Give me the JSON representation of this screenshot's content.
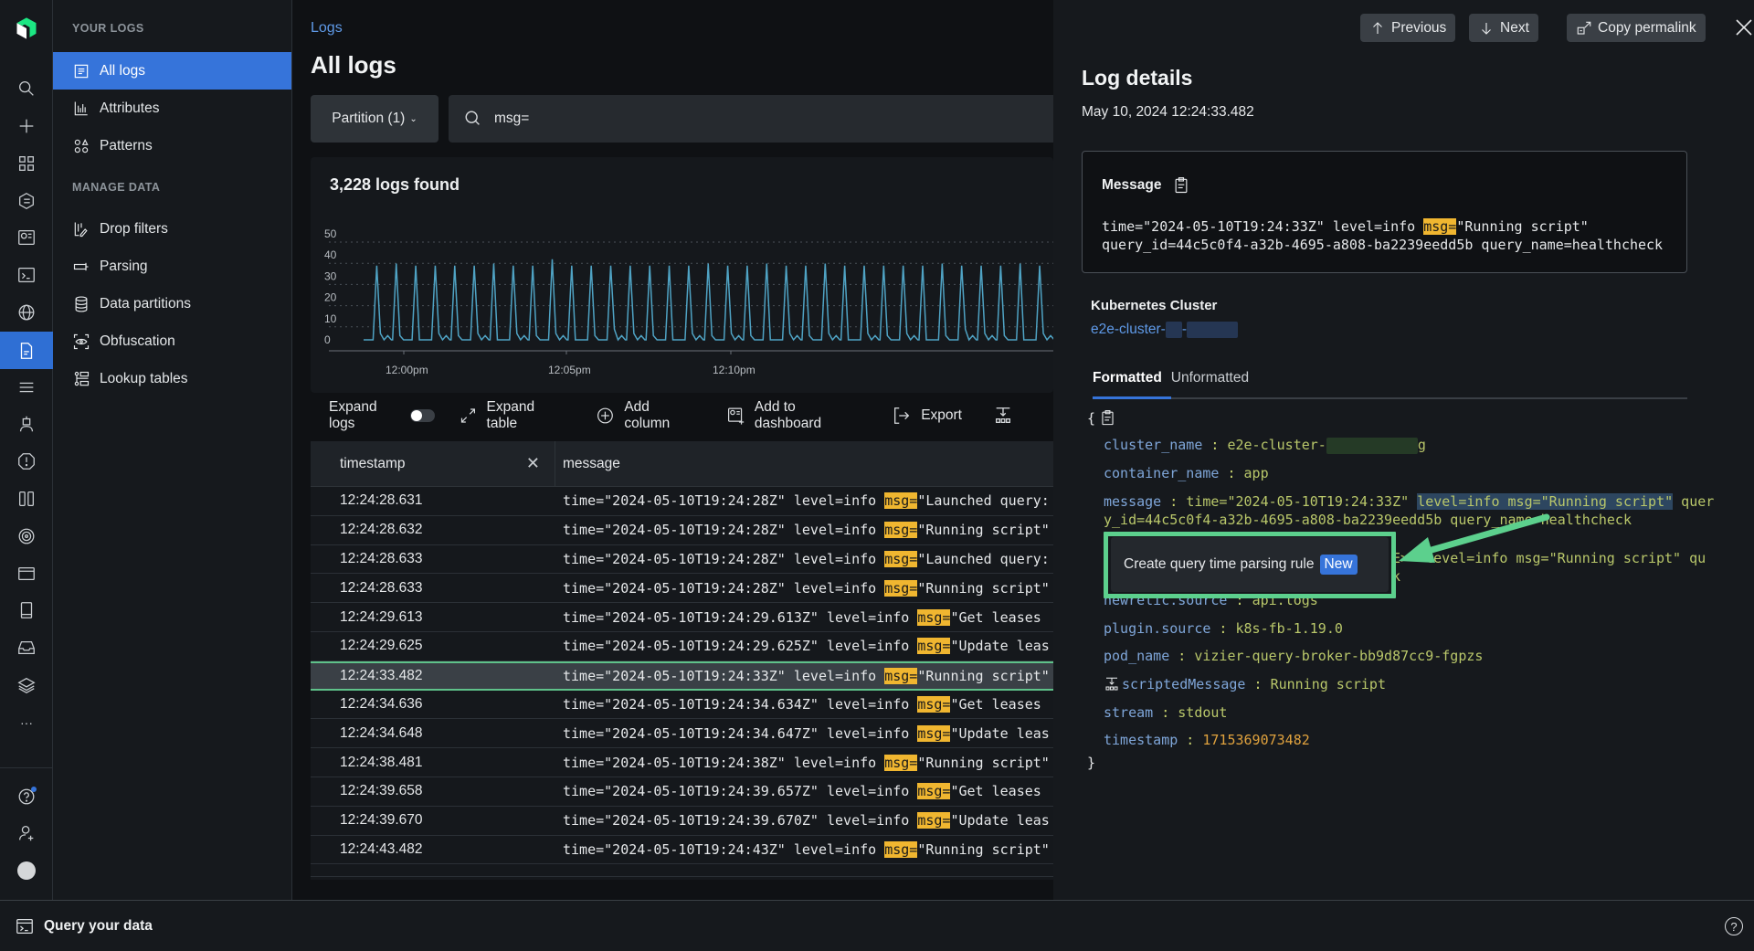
{
  "rail": {
    "icons": [
      "logo-icon",
      "search-icon",
      "plus-icon",
      "apps-grid-icon",
      "entity-hex-icon",
      "dashboard-icon",
      "terminal-icon",
      "globe-icon",
      "logs-icon",
      "sliders-icon",
      "robot-icon",
      "alert-icon",
      "columns-icon",
      "target-icon",
      "browser-icon",
      "mobile-icon",
      "inbox-icon",
      "layers-icon",
      "more-icon",
      "help-icon",
      "add-user-icon",
      "avatar-icon"
    ],
    "active": "logs-icon"
  },
  "nav": {
    "section1": "YOUR LOGS",
    "items1": [
      {
        "label": "All logs",
        "icon": "document-icon",
        "active": true
      },
      {
        "label": "Attributes",
        "icon": "bar-chart-icon"
      },
      {
        "label": "Patterns",
        "icon": "shapes-icon"
      }
    ],
    "section2": "MANAGE DATA",
    "items2": [
      {
        "label": "Drop filters",
        "icon": "drop-filter-icon"
      },
      {
        "label": "Parsing",
        "icon": "parsing-icon"
      },
      {
        "label": "Data partitions",
        "icon": "database-icon"
      },
      {
        "label": "Obfuscation",
        "icon": "eye-icon"
      },
      {
        "label": "Lookup tables",
        "icon": "lookup-table-icon"
      }
    ]
  },
  "main": {
    "breadcrumb": "Logs",
    "title": "All logs",
    "partition_label": "Partition (1)",
    "search_value": "msg=",
    "found": "3,228 logs found",
    "toolbar": {
      "expand_logs": "Expand logs",
      "expand_table": "Expand table",
      "add_column": "Add column",
      "add_dashboard": "Add to dashboard",
      "export": "Export"
    },
    "columns": [
      "timestamp",
      "message"
    ],
    "rows": [
      {
        "ts": "12:24:28.631",
        "pre": "time=\"2024-05-10T19:24:28Z\" level=info ",
        "hl": "msg=",
        "post": "\"Launched query:"
      },
      {
        "ts": "12:24:28.632",
        "pre": "time=\"2024-05-10T19:24:28Z\" level=info ",
        "hl": "msg=",
        "post": "\"Running script\""
      },
      {
        "ts": "12:24:28.633",
        "pre": "time=\"2024-05-10T19:24:28Z\" level=info ",
        "hl": "msg=",
        "post": "\"Launched query:"
      },
      {
        "ts": "12:24:28.633",
        "pre": "time=\"2024-05-10T19:24:28Z\" level=info ",
        "hl": "msg=",
        "post": "\"Running script\""
      },
      {
        "ts": "12:24:29.613",
        "pre": "time=\"2024-05-10T19:24:29.613Z\" level=info ",
        "hl": "msg=",
        "post": "\"Get leases"
      },
      {
        "ts": "12:24:29.625",
        "pre": "time=\"2024-05-10T19:24:29.625Z\" level=info ",
        "hl": "msg=",
        "post": "\"Update leas"
      },
      {
        "ts": "12:24:33.482",
        "pre": "time=\"2024-05-10T19:24:33Z\" level=info ",
        "hl": "msg=",
        "post": "\"Running script\"",
        "selected": true
      },
      {
        "ts": "12:24:34.636",
        "pre": "time=\"2024-05-10T19:24:34.634Z\" level=info ",
        "hl": "msg=",
        "post": "\"Get leases"
      },
      {
        "ts": "12:24:34.648",
        "pre": "time=\"2024-05-10T19:24:34.647Z\" level=info ",
        "hl": "msg=",
        "post": "\"Update leas"
      },
      {
        "ts": "12:24:38.481",
        "pre": "time=\"2024-05-10T19:24:38Z\" level=info ",
        "hl": "msg=",
        "post": "\"Running script\""
      },
      {
        "ts": "12:24:39.658",
        "pre": "time=\"2024-05-10T19:24:39.657Z\" level=info ",
        "hl": "msg=",
        "post": "\"Get leases"
      },
      {
        "ts": "12:24:39.670",
        "pre": "time=\"2024-05-10T19:24:39.670Z\" level=info ",
        "hl": "msg=",
        "post": "\"Update leas"
      },
      {
        "ts": "12:24:43.482",
        "pre": "time=\"2024-05-10T19:24:43Z\" level=info ",
        "hl": "msg=",
        "post": "\"Running script\""
      }
    ]
  },
  "chart_data": {
    "type": "line",
    "title": "3,228 logs found",
    "xlabel": "",
    "ylabel": "",
    "ylim": [
      0,
      50
    ],
    "yticks": [
      0,
      10,
      20,
      30,
      40,
      50
    ],
    "xtick_labels": [
      "12:00pm",
      "12:05pm",
      "12:10pm"
    ],
    "grid": true,
    "color": "#4fa3c4",
    "series": [
      {
        "name": "logs",
        "spike_values": [
          35,
          36,
          35,
          35,
          35,
          35,
          36,
          35,
          35,
          38,
          35,
          35,
          35,
          35,
          35,
          35,
          35,
          36,
          35,
          35,
          36,
          35,
          35,
          36,
          35,
          35,
          35,
          35,
          35,
          36,
          35,
          35,
          35,
          36,
          35
        ],
        "baseline": 0,
        "minor_values": [
          3,
          2,
          0,
          3,
          2,
          3,
          0,
          3,
          2,
          3,
          0,
          2,
          5,
          3,
          2,
          0,
          3,
          2
        ]
      }
    ]
  },
  "panel": {
    "prev": "Previous",
    "next": "Next",
    "copy": "Copy permalink",
    "title": "Log details",
    "date": "May 10, 2024 12:24:33.482",
    "message_label": "Message",
    "message_pre": "time=\"2024-05-10T19:24:33Z\" level=info ",
    "message_hl": "msg=",
    "message_post": "\"Running script\"",
    "message_line2": "query_id=44c5c0f4-a32b-4695-a808-ba2239eedd5b query_name=healthcheck",
    "k8s_label": "Kubernetes Cluster",
    "k8s_value": "e2e-cluster-",
    "tabs": [
      "Formatted",
      "Unformatted"
    ],
    "json": {
      "open": "{",
      "close": "}",
      "cluster_name_k": "cluster_name",
      "cluster_name_v": "e2e-cluster-",
      "container_name_k": "container_name",
      "container_name_v": "app",
      "message_k": "message",
      "message_v1": "time=\"2024-05-10T19:24:33Z\" ",
      "message_sel": "level=info msg=\"Running script\"",
      "message_v1b": " quer",
      "message_v2": "y_id=44c5c0f4-a32b-4695-a808-ba2239eedd5b query_name=healthcheck",
      "hidden_v1": "E>\" level=info msg=\"Running script\" qu",
      "hidden_v2": "k",
      "newrelic_k": "newrelic.source",
      "newrelic_v": "api.logs",
      "plugin_k": "plugin.source",
      "plugin_v": "k8s-fb-1.19.0",
      "pod_k": "pod_name",
      "pod_v": "vizier-query-broker-bb9d87cc9-fgpzs",
      "scripted_k": "scriptedMessage",
      "scripted_v": "Running script",
      "stream_k": "stream",
      "stream_v": "stdout",
      "timestamp_k": "timestamp",
      "timestamp_v": "1715369073482"
    },
    "tooltip": "Create query time parsing rule",
    "tooltip_badge": "New",
    "annotation_color": "#5cd08d"
  },
  "bottom": {
    "query_label": "Query your data"
  }
}
